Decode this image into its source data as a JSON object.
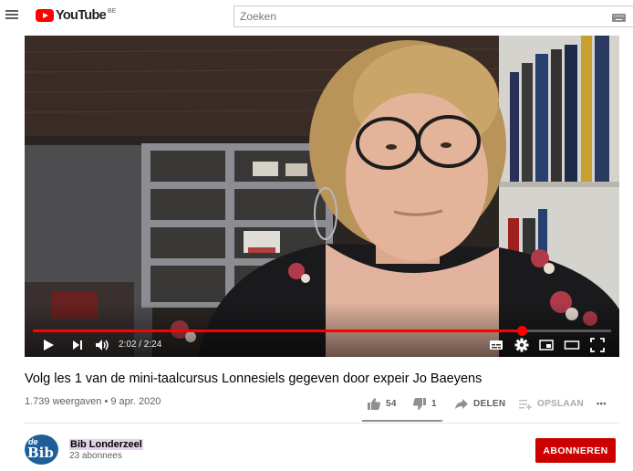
{
  "masthead": {
    "logo_text": "YouTube",
    "region": "BE",
    "search_placeholder": "Zoeken",
    "icons": [
      "hamburger-menu-icon",
      "keyboard-icon"
    ]
  },
  "player": {
    "time_display": "2:02 / 2:24",
    "progress_fraction": 0.847,
    "icons": [
      "play-icon",
      "next-icon",
      "volume-icon",
      "subtitles-icon",
      "settings-gear-icon",
      "miniplayer-icon",
      "theater-mode-icon",
      "fullscreen-icon"
    ],
    "colors": {
      "progress": "#ff0000"
    }
  },
  "video": {
    "title": "Volg les 1 van de mini-taalcursus Lonnesiels gegeven door expeir Jo Baeyens",
    "views": "1.739 weergaven",
    "separator": " • ",
    "date": "9 apr. 2020",
    "likes": "54",
    "dislikes": "1",
    "like_fraction": 0.98,
    "share_label": "DELEN",
    "save_label": "OPSLAAN",
    "more_label": "•••"
  },
  "owner": {
    "avatar_text_small": "de",
    "avatar_text_large": "Bib",
    "channel_name": "Bib Londerzeel",
    "subscribers": "23 abonnees",
    "subscribe_label": "ABONNEREN",
    "colors": {
      "subscribe": "#cc0000",
      "avatar": "#1f5f99"
    }
  }
}
